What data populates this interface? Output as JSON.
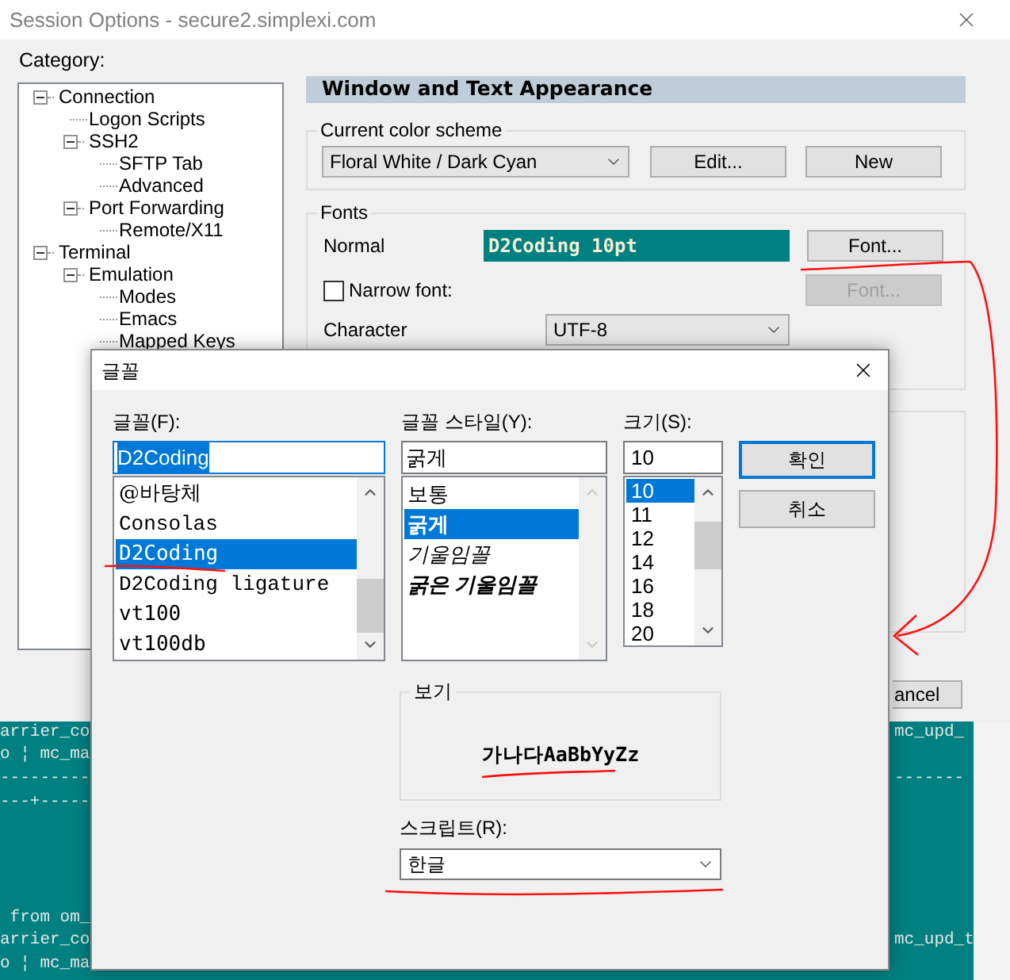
{
  "window": {
    "title": "Session Options - secure2.simplexi.com"
  },
  "category_label": "Category:",
  "tree": [
    {
      "label": "Connection",
      "expanded": true,
      "children": [
        {
          "label": "Logon Scripts"
        },
        {
          "label": "SSH2",
          "expanded": true,
          "children": [
            {
              "label": "SFTP Tab"
            },
            {
              "label": "Advanced"
            }
          ]
        },
        {
          "label": "Port Forwarding",
          "expanded": true,
          "children": [
            {
              "label": "Remote/X11"
            }
          ]
        }
      ]
    },
    {
      "label": "Terminal",
      "expanded": true,
      "children": [
        {
          "label": "Emulation",
          "expanded": true,
          "children": [
            {
              "label": "Modes"
            },
            {
              "label": "Emacs"
            },
            {
              "label": "Mapped Keys"
            }
          ]
        }
      ]
    }
  ],
  "panel_title": "Window and Text Appearance",
  "color_scheme": {
    "legend": "Current color scheme",
    "value": "Floral White / Dark Cyan",
    "edit_button": "Edit...",
    "new_button": "New"
  },
  "fonts": {
    "legend": "Fonts",
    "normal_label": "Normal",
    "normal_value": "D2Coding 10pt",
    "font_button": {
      "label": "Font...",
      "disabled": false
    },
    "narrow": {
      "label": "Narrow font:",
      "checked": false
    },
    "narrow_button": {
      "label": "Font...",
      "disabled": true
    },
    "character_label": "Character",
    "character_value": "UTF-8"
  },
  "cancel_button": "ancel",
  "terminal": [
    {
      "kind": "text",
      "left": "arrier_co",
      "right": "mc_upd_"
    },
    {
      "kind": "text",
      "left": "o ¦ mc_ma"
    },
    {
      "kind": "text",
      "left": "---------",
      "right": "-------"
    },
    {
      "kind": "text",
      "left": "---+-----"
    },
    {
      "kind": "blank"
    },
    {
      "kind": "blank"
    },
    {
      "kind": "blank"
    },
    {
      "kind": "blank"
    },
    {
      "kind": "text",
      "left": " from om_"
    },
    {
      "kind": "text",
      "left": "arrier_co",
      "right": "mc_upd_t"
    },
    {
      "kind": "text",
      "left": "o ¦ mc_ma"
    }
  ],
  "font_dialog": {
    "title": "글꼴",
    "font": {
      "label": "글꼴(F):",
      "value": "D2Coding",
      "text_selected": true,
      "items": [
        {
          "label": "@바탕체",
          "kind": "serif",
          "selected": false
        },
        {
          "label": "Consolas",
          "kind": "mono",
          "selected": false
        },
        {
          "label": "D2Coding",
          "kind": "sans",
          "selected": true
        },
        {
          "label": "D2Coding ligature",
          "kind": "mono",
          "selected": false
        },
        {
          "label": "vt100",
          "kind": "sans",
          "selected": false
        },
        {
          "label": "vt100db",
          "kind": "sans",
          "selected": false
        }
      ]
    },
    "style": {
      "label": "글꼴 스타일(Y):",
      "value": "굵게",
      "items": [
        {
          "label": "보통",
          "kind": "regular",
          "selected": false
        },
        {
          "label": "굵게",
          "kind": "bold",
          "selected": true
        },
        {
          "label": "기울임꼴",
          "kind": "italic",
          "selected": false
        },
        {
          "label": "굵은 기울임꼴",
          "kind": "bold-italic",
          "selected": false
        }
      ]
    },
    "size": {
      "label": "크기(S):",
      "value": "10",
      "items": [
        {
          "label": "10",
          "selected": true
        },
        {
          "label": "11",
          "selected": false
        },
        {
          "label": "12",
          "selected": false
        },
        {
          "label": "14",
          "selected": false
        },
        {
          "label": "16",
          "selected": false
        },
        {
          "label": "18",
          "selected": false
        },
        {
          "label": "20",
          "selected": false
        }
      ]
    },
    "ok_button": {
      "label": "확인",
      "default": true
    },
    "cancel_button": {
      "label": "취소",
      "default": false
    },
    "preview": {
      "legend": "보기",
      "sample": "가나다AaBbYyZz"
    },
    "script": {
      "label": "스크립트(R):",
      "value": "한글"
    }
  }
}
